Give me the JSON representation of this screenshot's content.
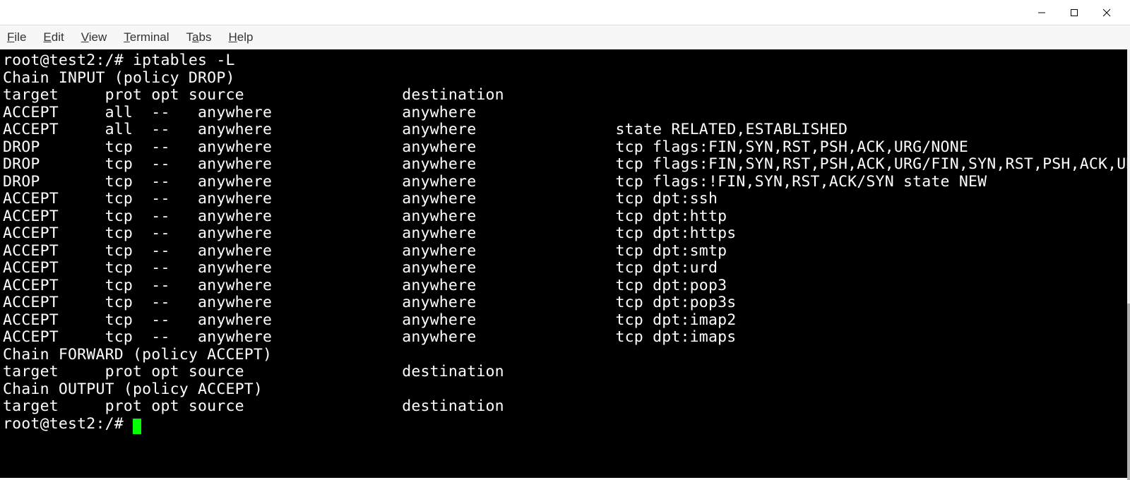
{
  "menubar": {
    "file": "File",
    "edit": "Edit",
    "view": "View",
    "terminal": "Terminal",
    "tabs": "Tabs",
    "help": "Help"
  },
  "prompt": {
    "user_host": "root@test2",
    "path": "/",
    "symbol": "#",
    "command": "iptables -L"
  },
  "output": {
    "chain_input_header": "Chain INPUT (policy DROP)",
    "columns": {
      "target": "target",
      "prot": "prot",
      "opt": "opt",
      "source": "source",
      "destination": "destination"
    },
    "input_rules": [
      {
        "target": "ACCEPT",
        "prot": "all",
        "opt": "--",
        "source": "anywhere",
        "destination": "anywhere",
        "extra": ""
      },
      {
        "target": "ACCEPT",
        "prot": "all",
        "opt": "--",
        "source": "anywhere",
        "destination": "anywhere",
        "extra": "state RELATED,ESTABLISHED"
      },
      {
        "target": "DROP",
        "prot": "tcp",
        "opt": "--",
        "source": "anywhere",
        "destination": "anywhere",
        "extra": "tcp flags:FIN,SYN,RST,PSH,ACK,URG/NONE"
      },
      {
        "target": "DROP",
        "prot": "tcp",
        "opt": "--",
        "source": "anywhere",
        "destination": "anywhere",
        "extra": "tcp flags:FIN,SYN,RST,PSH,ACK,URG/FIN,SYN,RST,PSH,ACK,URG"
      },
      {
        "target": "DROP",
        "prot": "tcp",
        "opt": "--",
        "source": "anywhere",
        "destination": "anywhere",
        "extra": "tcp flags:!FIN,SYN,RST,ACK/SYN state NEW"
      },
      {
        "target": "ACCEPT",
        "prot": "tcp",
        "opt": "--",
        "source": "anywhere",
        "destination": "anywhere",
        "extra": "tcp dpt:ssh"
      },
      {
        "target": "ACCEPT",
        "prot": "tcp",
        "opt": "--",
        "source": "anywhere",
        "destination": "anywhere",
        "extra": "tcp dpt:http"
      },
      {
        "target": "ACCEPT",
        "prot": "tcp",
        "opt": "--",
        "source": "anywhere",
        "destination": "anywhere",
        "extra": "tcp dpt:https"
      },
      {
        "target": "ACCEPT",
        "prot": "tcp",
        "opt": "--",
        "source": "anywhere",
        "destination": "anywhere",
        "extra": "tcp dpt:smtp"
      },
      {
        "target": "ACCEPT",
        "prot": "tcp",
        "opt": "--",
        "source": "anywhere",
        "destination": "anywhere",
        "extra": "tcp dpt:urd"
      },
      {
        "target": "ACCEPT",
        "prot": "tcp",
        "opt": "--",
        "source": "anywhere",
        "destination": "anywhere",
        "extra": "tcp dpt:pop3"
      },
      {
        "target": "ACCEPT",
        "prot": "tcp",
        "opt": "--",
        "source": "anywhere",
        "destination": "anywhere",
        "extra": "tcp dpt:pop3s"
      },
      {
        "target": "ACCEPT",
        "prot": "tcp",
        "opt": "--",
        "source": "anywhere",
        "destination": "anywhere",
        "extra": "tcp dpt:imap2"
      },
      {
        "target": "ACCEPT",
        "prot": "tcp",
        "opt": "--",
        "source": "anywhere",
        "destination": "anywhere",
        "extra": "tcp dpt:imaps"
      }
    ],
    "chain_forward_header": "Chain FORWARD (policy ACCEPT)",
    "chain_output_header": "Chain OUTPUT (policy ACCEPT)"
  },
  "colors": {
    "cursor": "#00ff00",
    "terminal_bg": "#000000",
    "terminal_fg": "#ffffff"
  }
}
